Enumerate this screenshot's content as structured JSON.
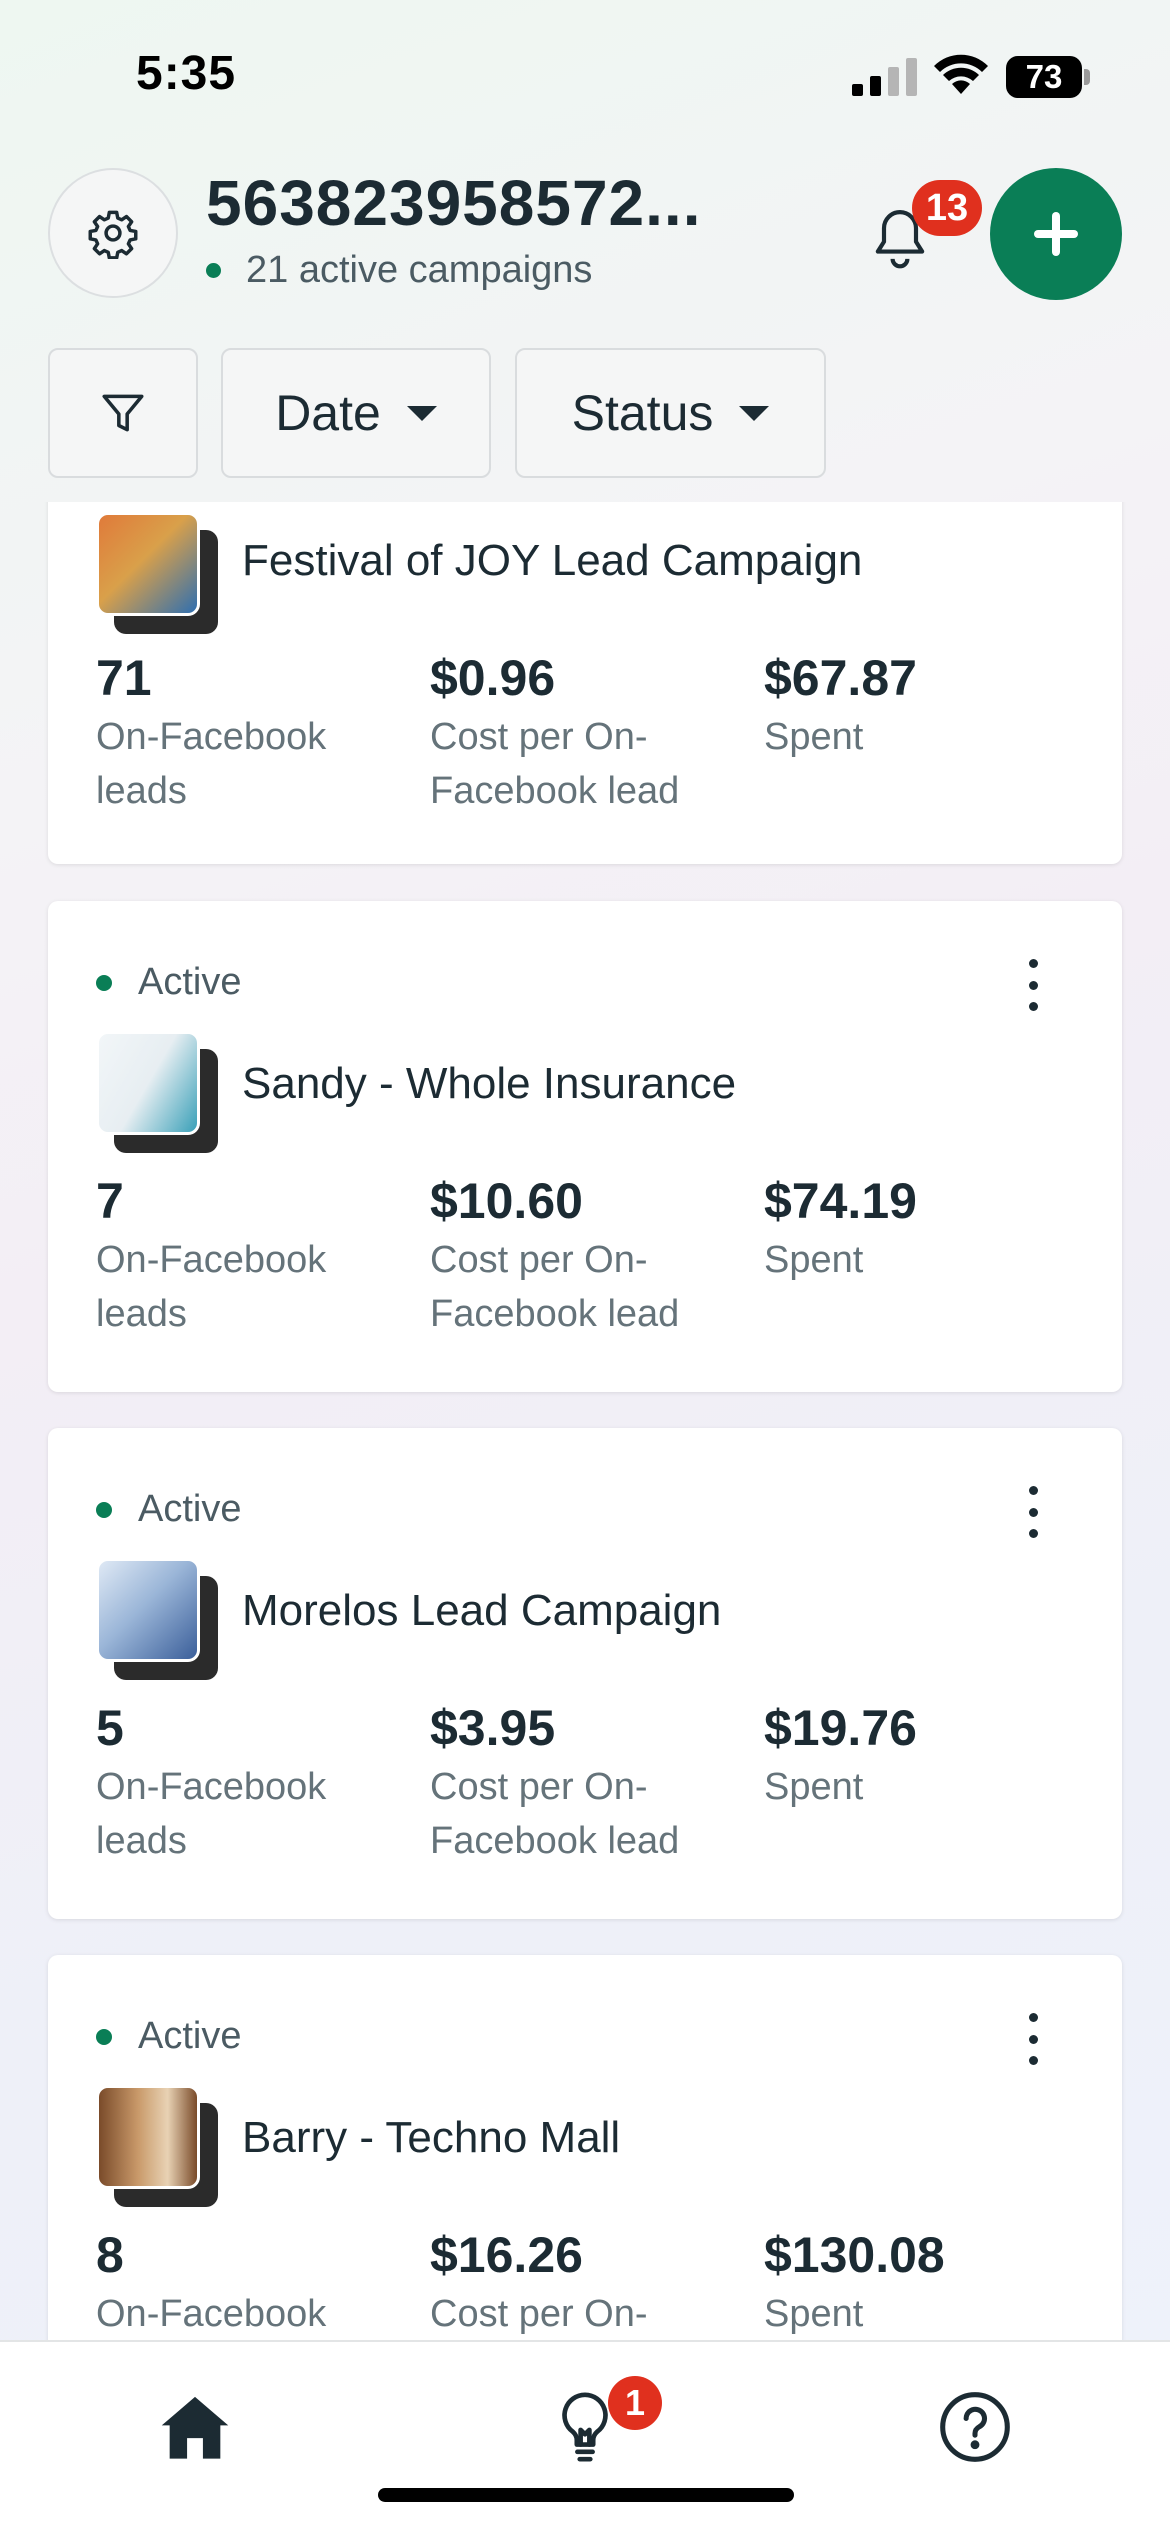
{
  "status_bar": {
    "time": "5:35",
    "battery_level": "73",
    "icons": [
      "signal-icon",
      "wifi-icon",
      "battery-icon"
    ]
  },
  "header": {
    "account_name": "563823958572...",
    "active_campaigns": "21 active campaigns",
    "notification_count": "13",
    "icons": [
      "gear-icon",
      "bell-icon",
      "plus-icon"
    ]
  },
  "filters": {
    "date_label": "Date",
    "status_label": "Status",
    "icons": [
      "filter-icon",
      "caret-down-icon"
    ]
  },
  "campaigns": [
    {
      "status": "",
      "name": "Festival of JOY Lead Campaign",
      "leads": "71",
      "leads_label": "On-Facebook leads",
      "cost": "$0.96",
      "cost_label": "Cost per On-Facebook lead",
      "spent": "$67.87",
      "spent_label": "Spent",
      "thumb_colors": [
        "#e07a3a",
        "#2f6fb0"
      ]
    },
    {
      "status": "Active",
      "name": "Sandy - Whole Insurance",
      "leads": "7",
      "leads_label": "On-Facebook leads",
      "cost": "$10.60",
      "cost_label": "Cost per On-Facebook lead",
      "spent": "$74.19",
      "spent_label": "Spent",
      "thumb_colors": [
        "#f2f6f8",
        "#3aa0b8"
      ]
    },
    {
      "status": "Active",
      "name": "Morelos Lead Campaign",
      "leads": "5",
      "leads_label": "On-Facebook leads",
      "cost": "$3.95",
      "cost_label": "Cost per On-Facebook lead",
      "spent": "$19.76",
      "spent_label": "Spent",
      "thumb_colors": [
        "#dfe9f5",
        "#3b5f9a"
      ]
    },
    {
      "status": "Active",
      "name": "Barry - Techno Mall",
      "leads": "8",
      "leads_label": "On-Facebook leads",
      "cost": "$16.26",
      "cost_label": "Cost per On-Facebook lead",
      "spent": "$130.08",
      "spent_label": "Spent",
      "thumb_colors": [
        "#c99a6a",
        "#7a4b2a"
      ]
    }
  ],
  "bottom_nav": {
    "tips_badge": "1",
    "icons": [
      "home-icon",
      "lightbulb-icon",
      "help-icon"
    ]
  },
  "colors": {
    "accent_green": "#0a7e56",
    "badge_red": "#e0301e",
    "text_primary": "#1c2b33",
    "text_secondary": "#65737a"
  }
}
